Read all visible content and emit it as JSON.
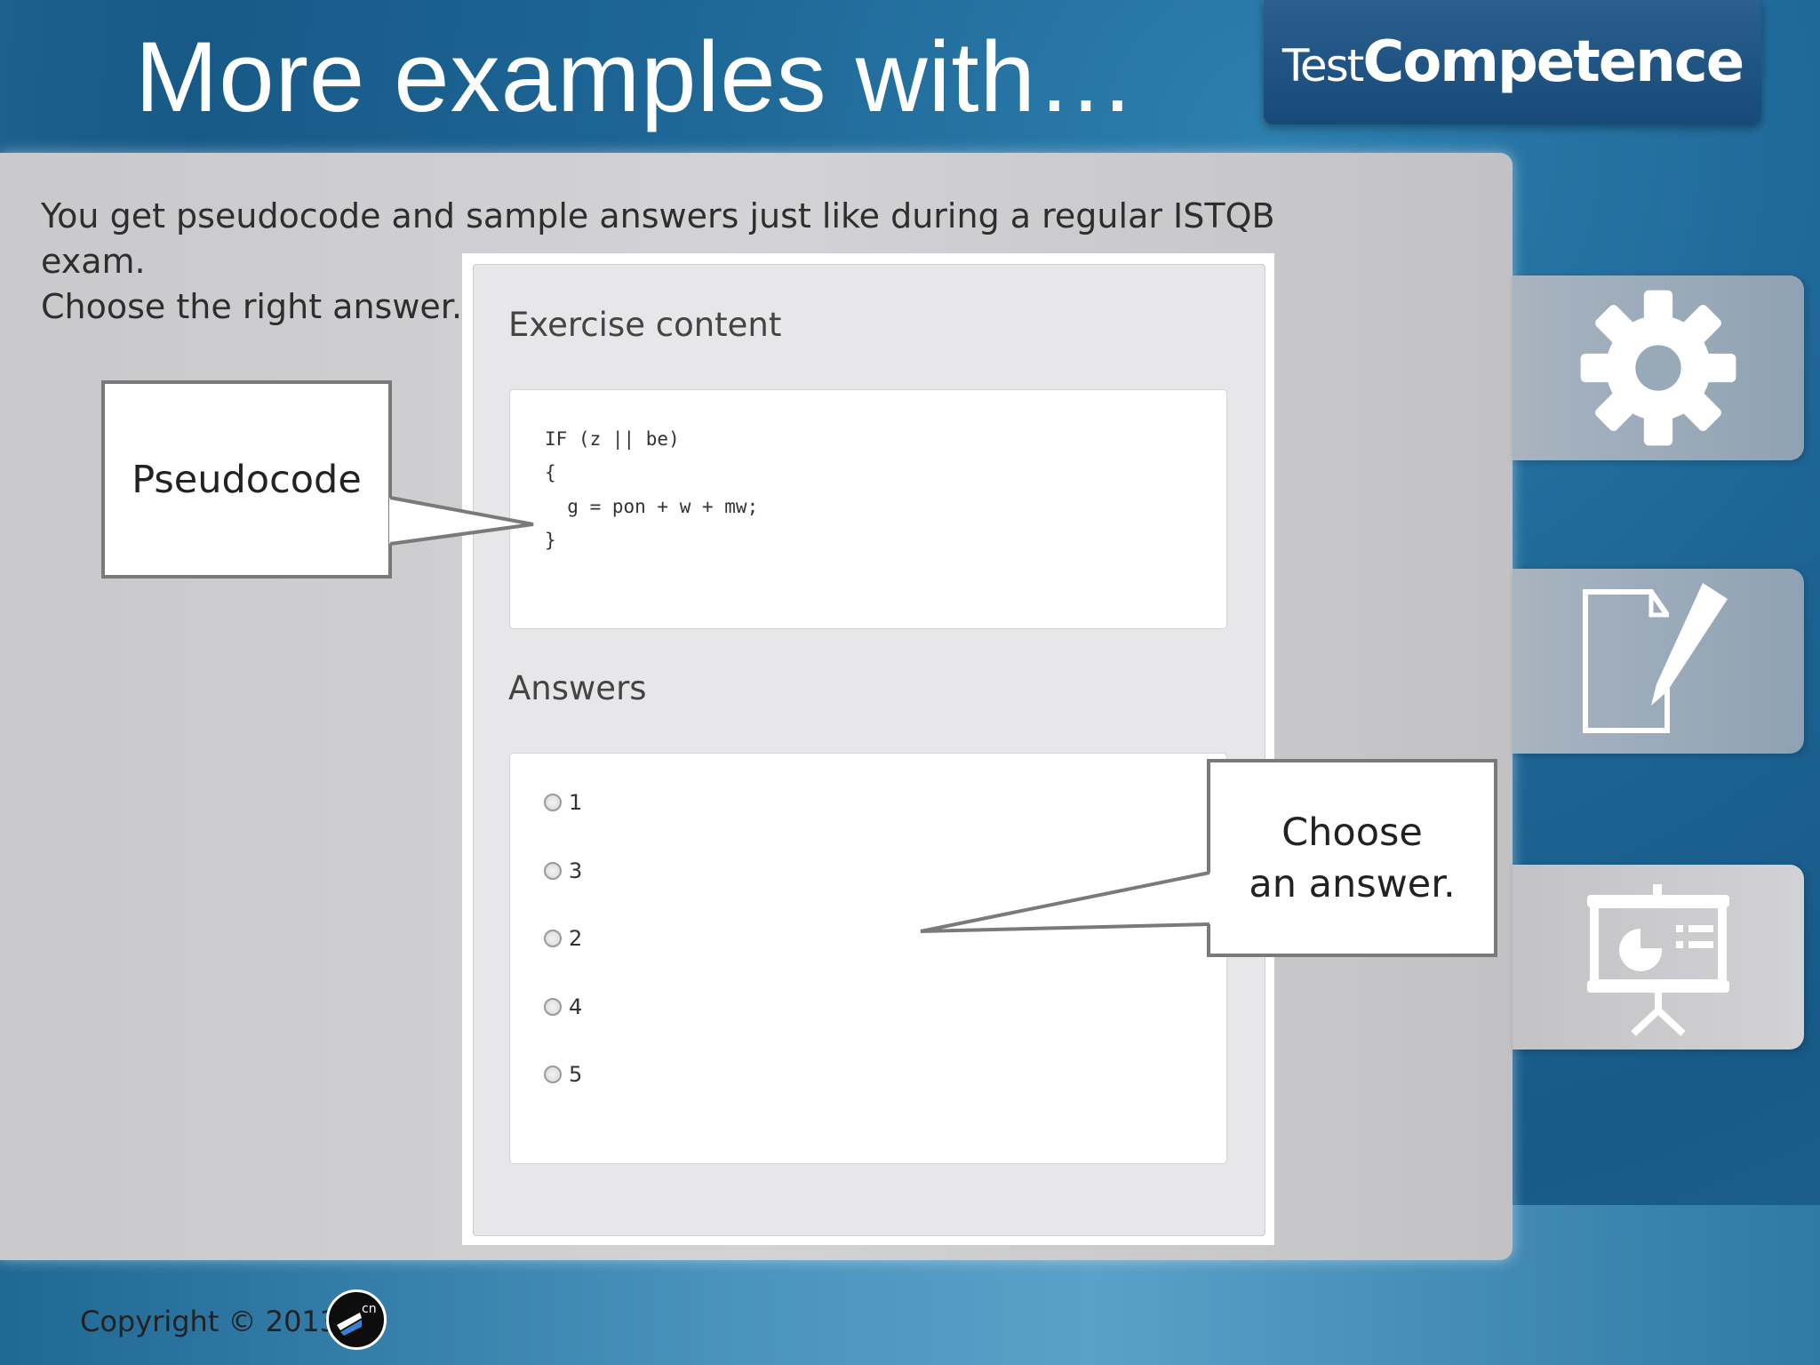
{
  "slide": {
    "title": "More examples with…",
    "intro_line1": "You get pseudocode and sample answers just like during a regular ISTQB exam.",
    "intro_line2": "Choose the right answer."
  },
  "logo": {
    "part1": "Test",
    "part2": "Competence"
  },
  "exercise": {
    "content_heading": "Exercise content",
    "code_lines": [
      "IF (z || be)",
      "{",
      "  g = pon + w + mw;",
      "}"
    ],
    "answers_heading": "Answers",
    "options": [
      "1",
      "3",
      "2",
      "4",
      "5"
    ]
  },
  "callouts": {
    "pseudocode": "Pseudocode",
    "choose_line1": "Choose",
    "choose_line2": "an answer."
  },
  "sidebar": {
    "tabs": [
      {
        "icon": "gear-icon"
      },
      {
        "icon": "document-edit-icon"
      },
      {
        "icon": "presentation-icon"
      }
    ]
  },
  "footer": {
    "copyright": "Copyright © 2013",
    "badge_text": "cn"
  },
  "colors": {
    "background": "#1d6595",
    "panel": "#cecece",
    "logo_bg": "#174a78"
  }
}
